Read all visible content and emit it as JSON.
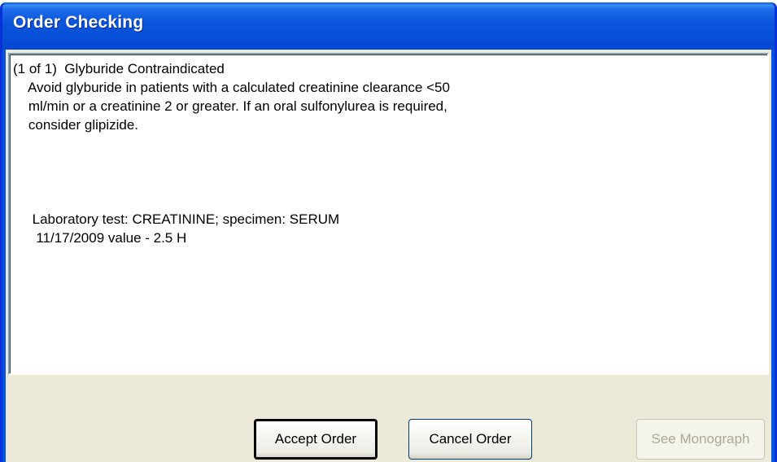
{
  "window": {
    "title": "Order Checking"
  },
  "message": {
    "lines": [
      "(1 of 1)  Glyburide Contraindicated",
      "    Avoid glyburide in patients with a calculated creatinine clearance <50",
      "    ml/min or a creatinine 2 or greater. If an oral sulfonylurea is required,",
      "    consider glipizide.",
      "",
      "",
      "",
      "     Laboratory test: CREATININE; specimen: SERUM",
      "      11/17/2009 value - 2.5 H"
    ]
  },
  "buttons": {
    "accept_label": "Accept Order",
    "cancel_label": "Cancel Order",
    "monograph_label": "See Monograph"
  },
  "colors": {
    "title_bar": "#0553e1",
    "client_bg": "#ece9d8",
    "disabled_text": "#aca899"
  }
}
